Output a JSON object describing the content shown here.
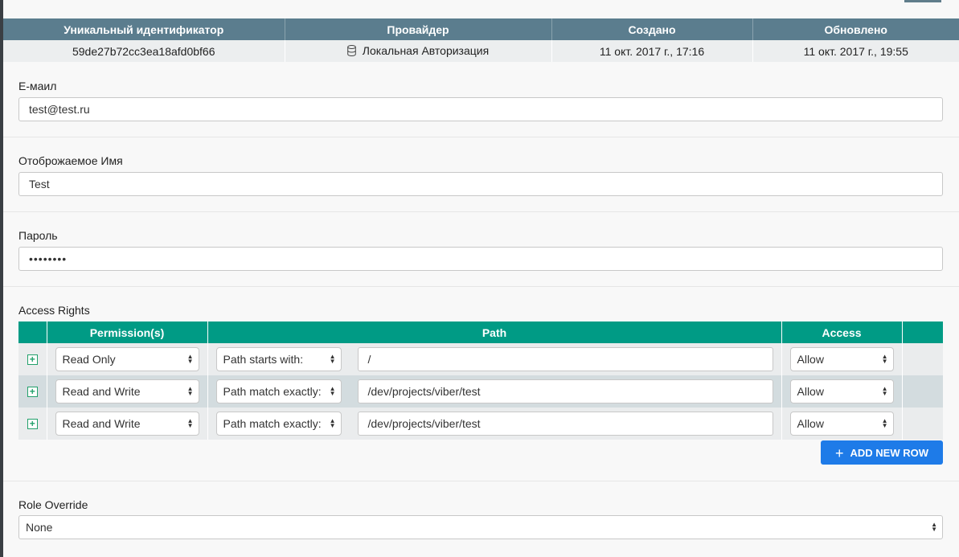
{
  "info": {
    "headers": [
      "Уникальный идентификатор",
      "Провайдер",
      "Создано",
      "Обновлено"
    ],
    "row": {
      "id": "59de27b72cc3ea18afd0bf66",
      "provider": "Локальная Авторизация",
      "created": "11 окт. 2017 г., 17:16",
      "updated": "11 окт. 2017 г., 19:55"
    }
  },
  "email": {
    "label": "E-маил",
    "value": "test@test.ru"
  },
  "display_name": {
    "label": "Отоброжаемое Имя",
    "value": "Test"
  },
  "password": {
    "label": "Пароль",
    "value": "••••••••"
  },
  "access_rights": {
    "label": "Access Rights",
    "headers": [
      "",
      "Permission(s)",
      "Path",
      "Access",
      ""
    ],
    "rows": [
      {
        "permission": "Read Only",
        "match": "Path starts with:",
        "path": "/",
        "access": "Allow"
      },
      {
        "permission": "Read and Write",
        "match": "Path match exactly:",
        "path": "/dev/projects/viber/test",
        "access": "Allow"
      },
      {
        "permission": "Read and Write",
        "match": "Path match exactly:",
        "path": "/dev/projects/viber/test",
        "access": "Allow"
      }
    ],
    "add_button": "ADD NEW ROW"
  },
  "role_override": {
    "label": "Role Override",
    "value": "None"
  },
  "colors": {
    "info_header": "#5b7d8e",
    "grid_header": "#009b85",
    "primary_button": "#1e7be8",
    "add_icon": "#22a06b"
  },
  "icons": {
    "provider": "database-icon",
    "add_row": "plus-square-icon",
    "select": "select-arrows-icon"
  }
}
